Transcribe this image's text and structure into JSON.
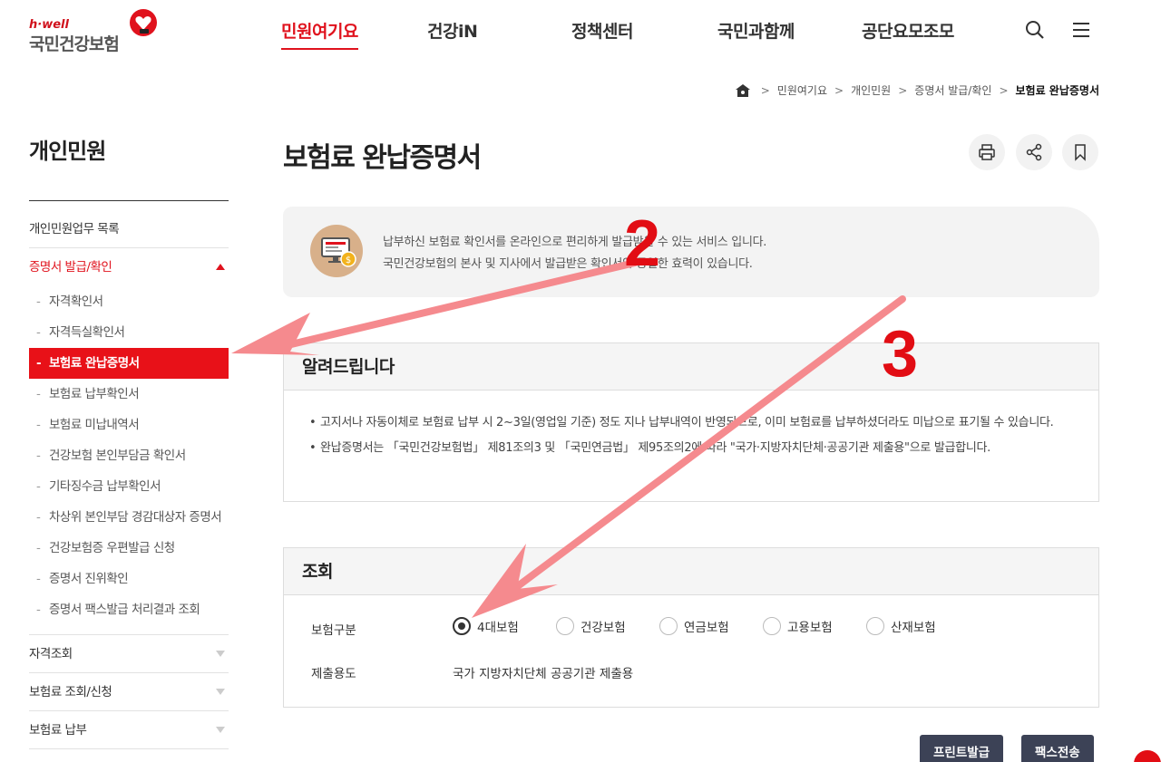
{
  "logo": {
    "tagline": "h·well",
    "name": "국민건강보험"
  },
  "gnb": [
    {
      "label": "민원여기요",
      "active": true
    },
    {
      "label": "건강iN",
      "active": false
    },
    {
      "label": "정책센터",
      "active": false
    },
    {
      "label": "국민과함께",
      "active": false
    },
    {
      "label": "공단요모조모",
      "active": false
    }
  ],
  "header_icons": [
    "search-icon",
    "hamburger-menu-icon"
  ],
  "breadcrumb": [
    "민원여기요",
    "개인민원",
    "증명서 발급/확인",
    "보험료 완납증명서"
  ],
  "sidebar": {
    "title": "개인민원",
    "items": [
      {
        "label": "개인민원업무 목록"
      },
      {
        "label": "증명서 발급/확인",
        "expanded": true
      },
      {
        "label": "자격조회"
      },
      {
        "label": "보험료 조회/신청"
      },
      {
        "label": "보험료 납부"
      }
    ],
    "sub_items": [
      "자격확인서",
      "자격득실확인서",
      "보험료 완납증명서",
      "보험료 납부확인서",
      "보험료 미납내역서",
      "건강보험 본인부담금 확인서",
      "기타징수금 납부확인서",
      "차상위 본인부담 경감대상자 증명서",
      "건강보험증 우편발급 신청",
      "증명서 진위확인",
      "증명서 팩스발급 처리결과 조회"
    ],
    "active_sub": "보험료 완납증명서"
  },
  "page": {
    "title": "보험료 완납증명서"
  },
  "tools": [
    "print-icon",
    "share-icon",
    "bookmark-icon"
  ],
  "intro": {
    "line1": "납부하신 보험료 확인서를 온라인으로 편리하게 발급받을 수 있는 서비스 입니다.",
    "line2": "국민건강보험의 본사 및 지사에서 발급받은 확인서와 동일한 효력이 있습니다."
  },
  "notice": {
    "title": "알려드립니다",
    "items": [
      "고지서나 자동이체로 보험료 납부 시 2~3일(영업일 기준) 정도 지나 납부내역이 반영되므로, 이미 보험료를 납부하셨더라도 미납으로 표기될 수 있습니다.",
      "완납증명서는 「국민건강보험법」 제81조의3 및 「국민연금법」 제95조의2에 따라 \"국가·지방자치단체·공공기관 제출용\"으로 발급합니다."
    ]
  },
  "inquiry": {
    "title": "조회",
    "type_label": "보험구분",
    "options": [
      "4대보험",
      "건강보험",
      "연금보험",
      "고용보험",
      "산재보험"
    ],
    "selected": "4대보험",
    "purpose_label": "제출용도",
    "purpose_value": "국가 지방자치단체 공공기관 제출용"
  },
  "buttons": {
    "print": "프린트발급",
    "fax": "팩스전송"
  },
  "annotations": {
    "n2": "2",
    "n3": "3",
    "color": "#e20d14",
    "arrow_color": "#f58a8e"
  },
  "colors": {
    "brand_red": "#e0121d",
    "dark_button": "#3c4256"
  }
}
